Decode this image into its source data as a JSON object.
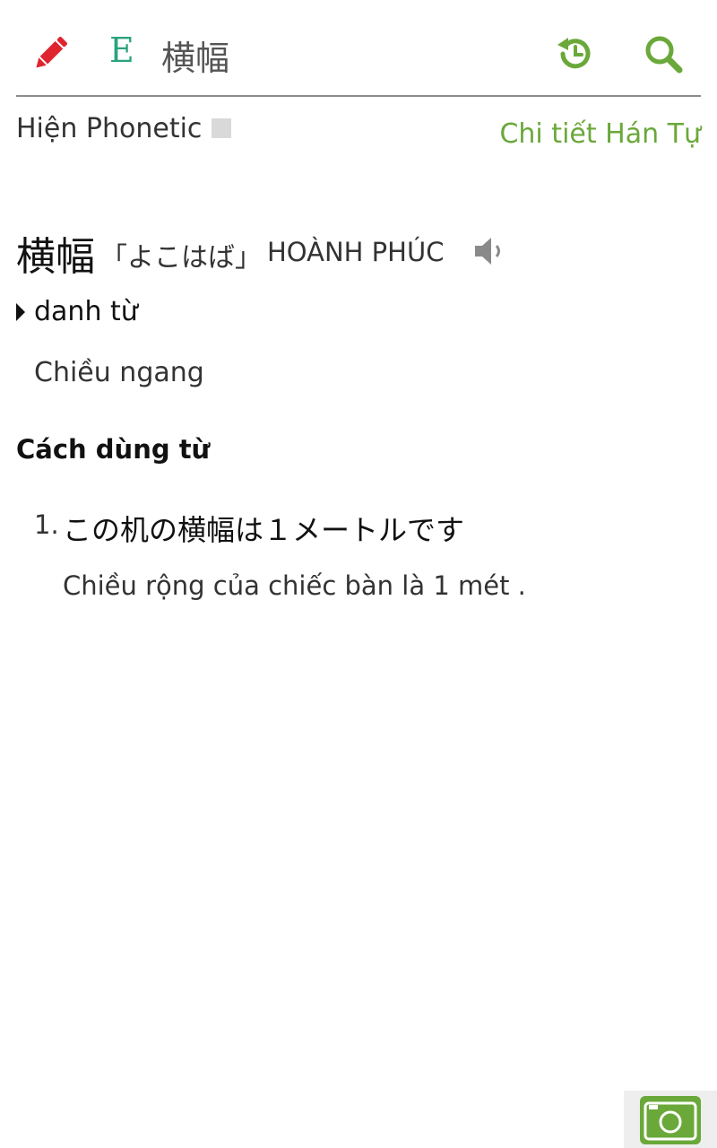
{
  "header": {
    "lang_badge": "E",
    "search_word": "横幅",
    "colors": {
      "accent": "#6aa83a",
      "edit": "#e0242f",
      "badge": "#2aa37d"
    }
  },
  "phonetic": {
    "label": "Hiện Phonetic",
    "checked": false,
    "kanji_detail_link": "Chi tiết Hán Tự"
  },
  "entry": {
    "word": "横幅",
    "reading": "「よこはば」",
    "han_viet": "HOÀNH PHÚC",
    "part_of_speech": "danh từ",
    "meaning": "Chiều ngang"
  },
  "usage": {
    "title": "Cách dùng từ",
    "examples": [
      {
        "number": "1.",
        "japanese": "この机の横幅は１メートルです",
        "vietnamese": "Chiều rộng của chiếc bàn là 1 mét ."
      }
    ]
  },
  "icons": {
    "edit": "pencil-icon",
    "history": "history-icon",
    "search": "search-icon",
    "speaker": "speaker-icon",
    "camera": "camera-icon"
  }
}
